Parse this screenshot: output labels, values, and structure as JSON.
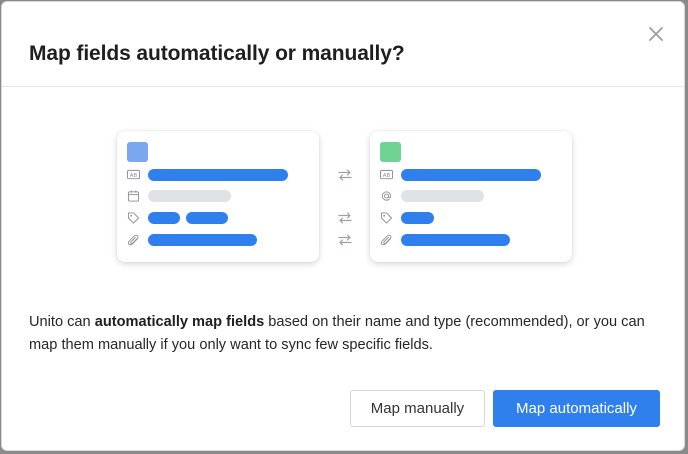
{
  "modal": {
    "title": "Map fields automatically or manually?",
    "description_lead": "Unito can ",
    "description_bold": "automatically map fields",
    "description_tail": " based on their name and type (recommended), or you can map them manually if you only want to sync few specific fields.",
    "buttons": {
      "manual_label": "Map manually",
      "auto_label": "Map automatically"
    }
  },
  "illustration": {
    "left_card": {
      "accent_color": "#7aa7f0",
      "label_icon_text": "AB"
    },
    "right_card": {
      "accent_color": "#6fd493",
      "label_icon_text": "AB"
    }
  },
  "colors": {
    "primary": "#2f80ed",
    "placeholder_gray": "#dfe2e7",
    "text": "#262626"
  }
}
